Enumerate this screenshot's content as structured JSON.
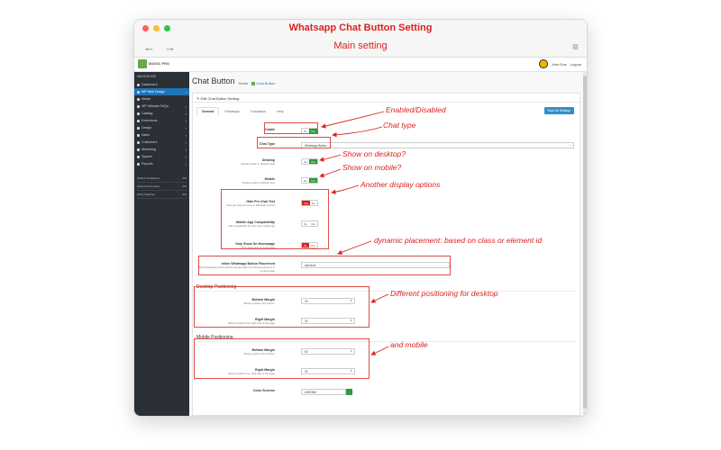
{
  "window": {
    "title": "Whatsapp Chat Button Setting",
    "subtitle": "Main setting",
    "traffic_colors": [
      "#ff5f57",
      "#febc2e",
      "#28c840"
    ]
  },
  "browser": {
    "back_icon": "arrow-left-icon",
    "forward_icon": "arrow-right-icon",
    "menu_icon": "hamburger-icon"
  },
  "appbar": {
    "logo_text": "MAGIC PRO",
    "user_name": "John Doe",
    "logout": "Logout"
  },
  "sidebar": {
    "header": "NAVIGATION",
    "items": [
      {
        "label": "Dashboard",
        "active": false
      },
      {
        "label": "WP Web Design",
        "active": true
      },
      {
        "label": "Media",
        "active": false
      },
      {
        "label": "WP Ultimate FAQs",
        "active": false
      },
      {
        "label": "Catalog",
        "active": false
      },
      {
        "label": "Extensions",
        "active": false
      },
      {
        "label": "Design",
        "active": false
      },
      {
        "label": "Sales",
        "active": false
      },
      {
        "label": "Customers",
        "active": false
      },
      {
        "label": "Marketing",
        "active": false
      },
      {
        "label": "System",
        "active": false
      },
      {
        "label": "Reports",
        "active": false
      }
    ],
    "stats": [
      {
        "label": "Orders Completed",
        "value": "0%"
      },
      {
        "label": "Orders Processing",
        "value": "0%"
      },
      {
        "label": "Other Statuses",
        "value": "0%"
      }
    ]
  },
  "page": {
    "title": "Chat Button",
    "breadcrumb_home": "Home",
    "breadcrumb_current": "Chat Button",
    "panel_heading": "Edit Chat Button Setting",
    "save_label": "Save All Settings",
    "tabs": [
      "General",
      "Whatsapp",
      "Translation",
      "Help"
    ]
  },
  "form": {
    "enable": {
      "label": "Enable",
      "no": "No",
      "yes": "Yes"
    },
    "chat_type": {
      "label": "Chat Type",
      "value": "Whatsapp Button"
    },
    "desktop": {
      "label": "Desktop",
      "help": "Display button in desktop view",
      "no": "No",
      "yes": "Yes"
    },
    "mobile": {
      "label": "Mobile",
      "help": "Display button in Mobile view",
      "no": "No",
      "yes": "Yes"
    },
    "hide_pre_chat": {
      "label": "Hide Pre Chat Text",
      "help": "Hide pre chat text once in Whatsapp button",
      "no": "No",
      "yes": "Yes"
    },
    "mobile_app": {
      "label": "Mobile App Compatibility",
      "help": "Add compatibility for web view mobile app",
      "no": "No",
      "yes": "Yes"
    },
    "only_home": {
      "label": "Only Show On Homepage",
      "help": "Only show chat on homepage",
      "no": "No",
      "yes": "Yes"
    },
    "inline_placement": {
      "label": "Inline Whatsapp Button Placement",
      "help": "Inline Whatsapp button will be inserted after the following element in product page",
      "value": "#product"
    },
    "desktop_section": "Desktop Positioning",
    "desktop_bottom": {
      "label": "Bottom Margin",
      "help": "Button position from bottom",
      "value": "30"
    },
    "desktop_right": {
      "label": "Right Margin",
      "help": "Button position from right side of the page",
      "value": "30"
    },
    "mobile_section": "Mobile Positioning",
    "mobile_bottom": {
      "label": "Bottom Margin",
      "help": "Button position from bottom",
      "value": "60"
    },
    "mobile_right": {
      "label": "Right Margin",
      "help": "Button position from right side of the page",
      "value": "30"
    },
    "color_scheme": {
      "label": "Color Scheme",
      "value": "#25D366",
      "swatch": "#2e9a3f"
    }
  },
  "annotations": {
    "enabled": "Enabled/Disabled",
    "chat_type": "Chat type",
    "desktop": "Show on desktop?",
    "mobile": "Show on mobile?",
    "other": "Another display options",
    "dynamic": "dynamic placement: based on class or element id",
    "desktop_pos": "Different positioning for desktop",
    "mobile_pos": "and mobile",
    "color": "#d9231d"
  }
}
